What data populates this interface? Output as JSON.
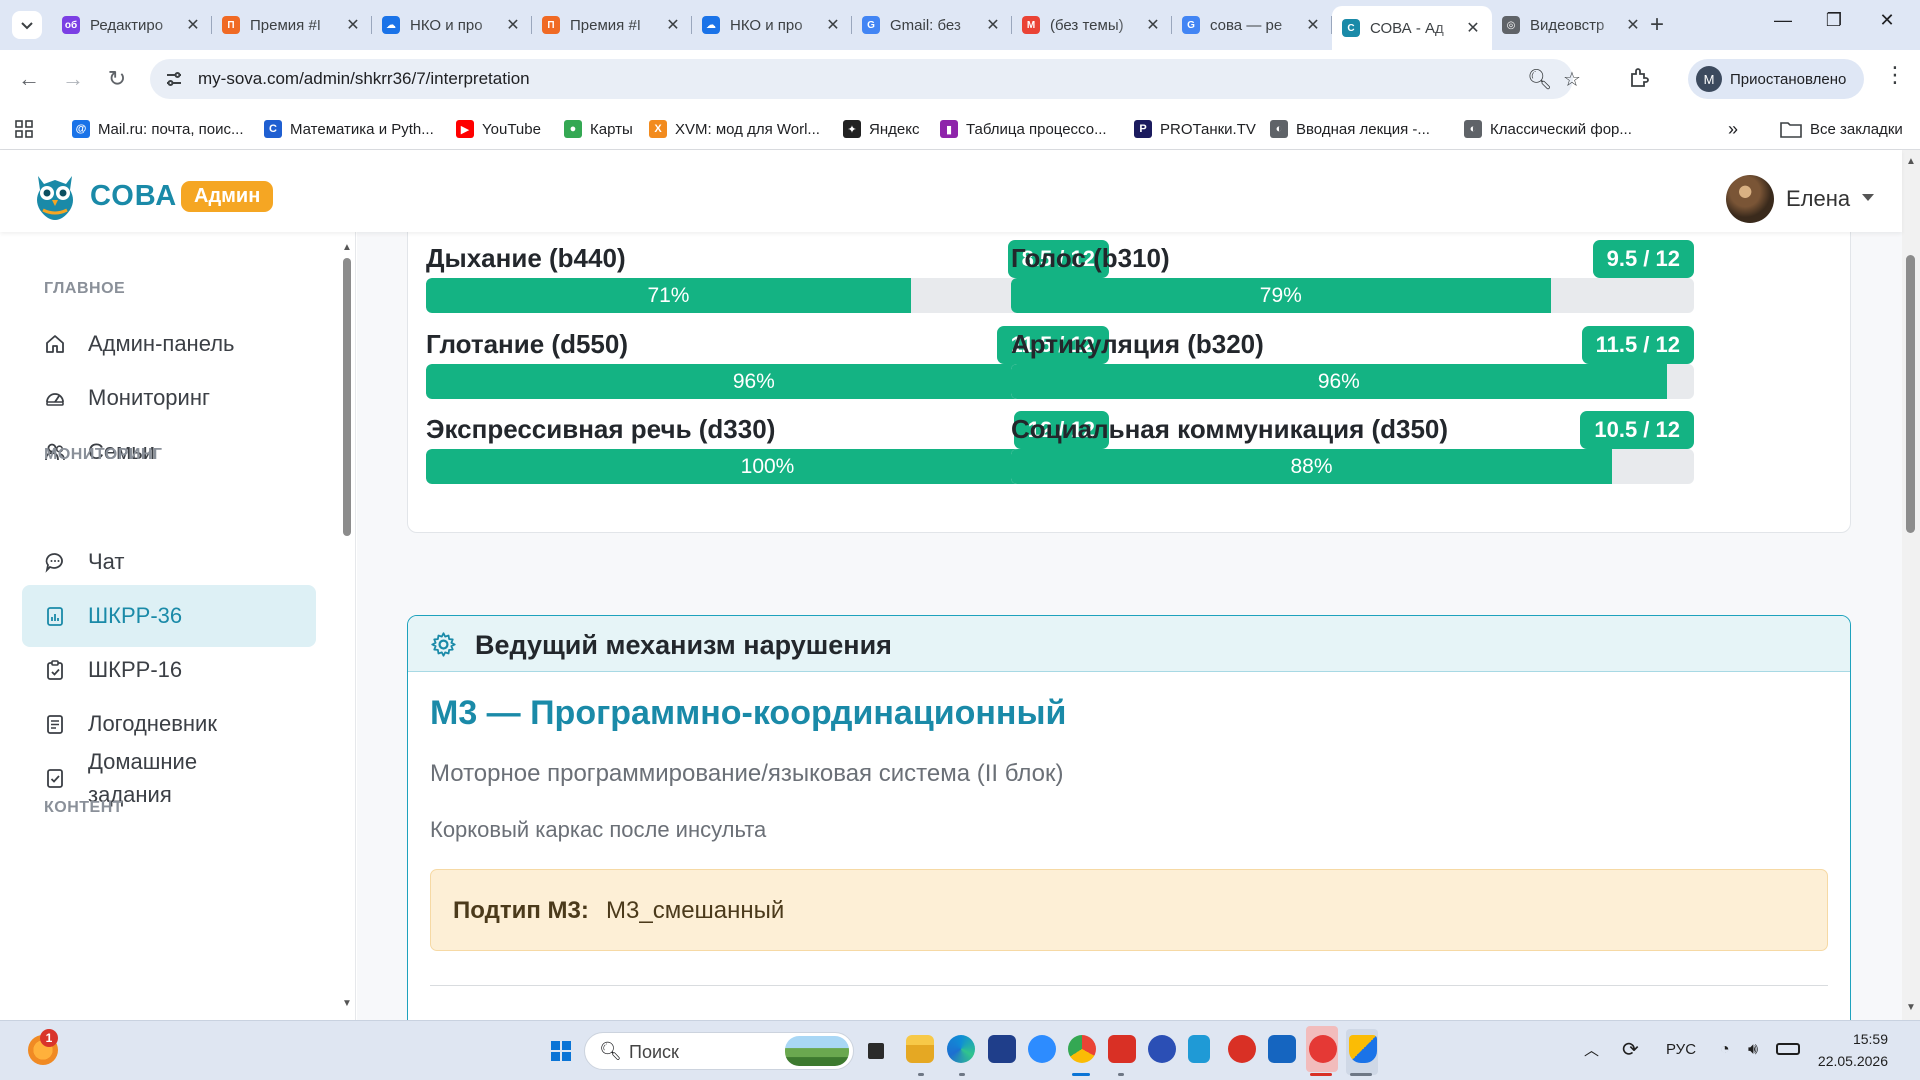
{
  "browser": {
    "tabs": [
      {
        "title": "Редактиро",
        "favicon_color": "#7b3fe4",
        "favicon_text": "об"
      },
      {
        "title": "Премия #I",
        "favicon_color": "#f06a24",
        "favicon_text": "П"
      },
      {
        "title": "НКО и про",
        "favicon_color": "#1a73e8",
        "favicon_text": "☁"
      },
      {
        "title": "Премия #I",
        "favicon_color": "#f06a24",
        "favicon_text": "П"
      },
      {
        "title": "НКО и про",
        "favicon_color": "#1a73e8",
        "favicon_text": "☁"
      },
      {
        "title": "Gmail: без",
        "favicon_color": "#4285f4",
        "favicon_text": "G"
      },
      {
        "title": "(без темы)",
        "favicon_color": "#ea4335",
        "favicon_text": "M"
      },
      {
        "title": "сова — ре",
        "favicon_color": "#4285f4",
        "favicon_text": "G"
      },
      {
        "title": "СОВА - Ад",
        "favicon_color": "#1a8aa8",
        "favicon_text": "С",
        "active": true
      },
      {
        "title": "Видеовстр",
        "favicon_color": "#5f6368",
        "favicon_text": "◎"
      }
    ],
    "url": "my-sova.com/admin/shkrr36/7/interpretation",
    "profile_label": "Приостановлено",
    "profile_initial": "M",
    "bookmarks": [
      {
        "label": "Mail.ru: почта, поис...",
        "color": "#1a73e8",
        "text": "@"
      },
      {
        "label": "Математика и Pyth...",
        "color": "#1f5fd1",
        "text": "C"
      },
      {
        "label": "YouTube",
        "color": "#ff0000",
        "text": "▶"
      },
      {
        "label": "Карты",
        "color": "#34a853",
        "text": "●"
      },
      {
        "label": "XVM: мод для Worl...",
        "color": "#f28b1e",
        "text": "X"
      },
      {
        "label": "Яндекс",
        "color": "#222222",
        "text": "✦"
      },
      {
        "label": "Таблица процессо...",
        "color": "#8e24aa",
        "text": "▮"
      },
      {
        "label": "PROТанки.TV",
        "color": "#1b1b5e",
        "text": "P"
      },
      {
        "label": "Вводная лекция -...",
        "color": "#5f6368",
        "text": "◐"
      },
      {
        "label": "Классический фор...",
        "color": "#5f6368",
        "text": "◐"
      }
    ],
    "all_bookmarks_label": "Все закладки"
  },
  "header": {
    "logo_text": "СОВА",
    "admin_badge": "Админ",
    "user_name": "Елена"
  },
  "sidebar": {
    "sections": [
      {
        "title": "ГЛАВНОЕ"
      },
      {
        "title": "МОНИТОРИНГ"
      },
      {
        "title": "КОНТЕНТ"
      }
    ],
    "items": [
      {
        "label": "Админ-панель",
        "icon": "home-icon"
      },
      {
        "label": "Мониторинг",
        "icon": "gauge-icon"
      },
      {
        "label": "Семьи",
        "icon": "users-icon"
      },
      {
        "label": "Чат",
        "icon": "chat-icon"
      },
      {
        "label": "ШКРР-36",
        "icon": "chart-report-icon",
        "active": true
      },
      {
        "label": "ШКРР-16",
        "icon": "clipboard-check-icon"
      },
      {
        "label": "Логодневник",
        "icon": "journal-icon"
      },
      {
        "label": "Домашние задания",
        "label_line1": "Домашние",
        "label_line2": "задания",
        "icon": "checklist-icon"
      }
    ]
  },
  "metrics": [
    {
      "label": "Дыхание (b440)",
      "score": "8.5 / 12",
      "percent_text": "71%",
      "percent": 71
    },
    {
      "label": "Голос (b310)",
      "score": "9.5 / 12",
      "percent_text": "79%",
      "percent": 79
    },
    {
      "label": "Глотание (d550)",
      "score": "11.5 / 12",
      "percent_text": "96%",
      "percent": 96
    },
    {
      "label": "Артикуляция (b320)",
      "score": "11.5 / 12",
      "percent_text": "96%",
      "percent": 96
    },
    {
      "label": "Экспрессивная речь (d330)",
      "score": "12 / 12",
      "percent_text": "100%",
      "percent": 100
    },
    {
      "label": "Социальная коммуникация (d350)",
      "score": "10.5 / 12",
      "percent_text": "88%",
      "percent": 88
    }
  ],
  "mechanism": {
    "header": "Ведущий механизм нарушения",
    "name": "М3 — Программно-координационный",
    "description": "Моторное программирование/языковая система (II блок)",
    "note": "Корковый каркас после инсульта",
    "subtype_label": "Подтип М3:",
    "subtype_value": "М3_смешанный"
  },
  "taskbar": {
    "search_placeholder": "Поиск",
    "notification_count": "1",
    "language": "РУС",
    "time": "15:59",
    "date": "22.05.2026"
  },
  "colors": {
    "brand": "#1a8aa8",
    "admin_badge": "#f5a623",
    "progress": "#14b383",
    "active_item_bg": "#ddf0f5",
    "subtype_bg": "#fdefd6"
  }
}
